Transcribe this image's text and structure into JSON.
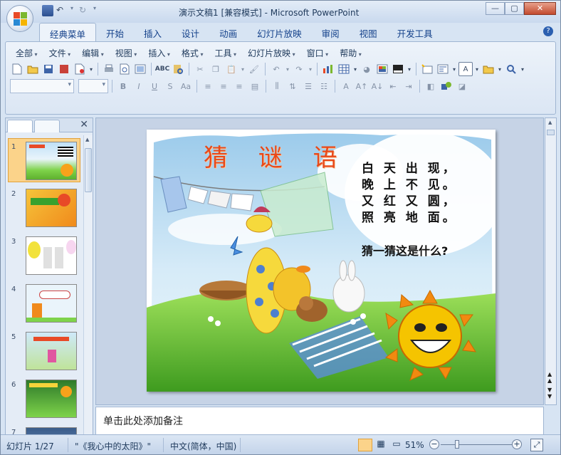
{
  "window": {
    "title": "演示文稿1 [兼容模式] - Microsoft PowerPoint"
  },
  "ribbon_tabs": [
    {
      "label": "经典菜单",
      "active": true
    },
    {
      "label": "开始"
    },
    {
      "label": "插入"
    },
    {
      "label": "设计"
    },
    {
      "label": "动画"
    },
    {
      "label": "幻灯片放映"
    },
    {
      "label": "审阅"
    },
    {
      "label": "视图"
    },
    {
      "label": "开发工具"
    }
  ],
  "classic_menu": [
    "全部",
    "文件",
    "编辑",
    "视图",
    "插入",
    "格式",
    "工具",
    "幻灯片放映",
    "窗口",
    "帮助"
  ],
  "slide": {
    "title": "猜 谜 语",
    "riddle_lines": [
      "白 天 出 现，",
      "晚 上 不 见。",
      "又 红 又 圆，",
      "照 亮 地 面。"
    ],
    "question": "猜一猜这是什么?"
  },
  "thumbnails": [
    {
      "num": "1",
      "selected": true
    },
    {
      "num": "2"
    },
    {
      "num": "3"
    },
    {
      "num": "4"
    },
    {
      "num": "5"
    },
    {
      "num": "6"
    },
    {
      "num": "7"
    }
  ],
  "notes": {
    "placeholder": "单击此处添加备注"
  },
  "status": {
    "slide_info": "幻灯片 1/27",
    "theme": "\"《我心中的太阳》\"",
    "language": "中文(简体，中国)",
    "zoom": "51%"
  },
  "colors": {
    "accent": "#e8491a",
    "selected_thumb": "#fbd38a",
    "ribbon": "#dbe6f4"
  }
}
